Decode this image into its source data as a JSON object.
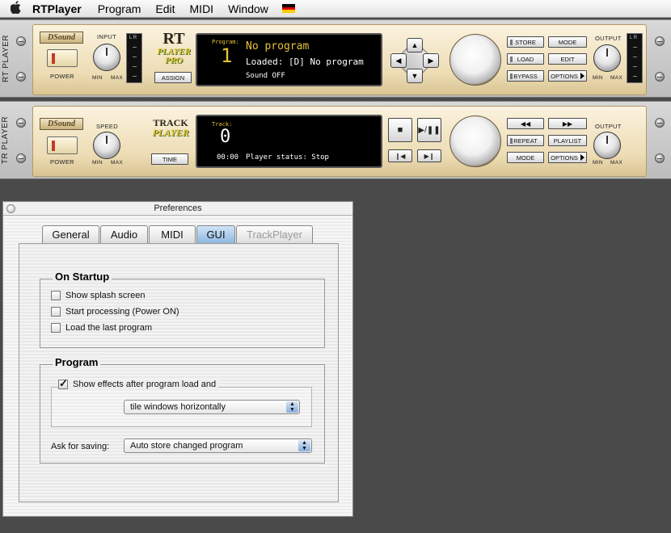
{
  "menubar": {
    "apple": "",
    "app_name": "RTPlayer",
    "items": [
      "Program",
      "Edit",
      "MIDI",
      "Window"
    ],
    "flag_colors": [
      "#000000",
      "#dd0000",
      "#ffcc00"
    ]
  },
  "rt_player": {
    "side_label": "RT PLAYER",
    "logo": "DSound",
    "power_label": "POWER",
    "input_label": "INPUT",
    "min_label": "MIN",
    "max_label": "MAX",
    "brand_line1": "RT",
    "brand_line2": "PLAYER",
    "brand_line3": "PRO",
    "assign_label": "ASSIGN",
    "screen": {
      "program_caption": "Program:",
      "program_number": "1",
      "program_name": "No program",
      "loaded": "Loaded: [D] No program",
      "sound": "Sound OFF"
    },
    "buttons": {
      "store": "STORE",
      "mode": "MODE",
      "load": "LOAD",
      "edit": "EDIT",
      "bypass": "BYPASS",
      "options": "OPTIONS"
    },
    "output_label": "OUTPUT"
  },
  "tr_player": {
    "side_label": "TR PLAYER",
    "logo": "DSound",
    "power_label": "POWER",
    "speed_label": "SPEED",
    "min_label": "MIN",
    "max_label": "MAX",
    "brand_line1": "TRACK",
    "brand_line2": "PLAYER",
    "time_label": "TIME",
    "screen": {
      "track_caption": "Track:",
      "track_number": "0",
      "time": "00:00",
      "status": "Player status: Stop"
    },
    "buttons": {
      "rewind": "◀◀",
      "forward": "▶▶",
      "repeat": "REPEAT",
      "playlist": "PLAYLIST",
      "mode": "MODE",
      "options": "OPTIONS"
    },
    "output_label": "OUTPUT"
  },
  "preferences": {
    "title": "Preferences",
    "tabs": [
      "General",
      "Audio",
      "MIDI",
      "GUI",
      "TrackPlayer"
    ],
    "active_tab": "GUI",
    "on_startup": {
      "title": "On Startup",
      "options": [
        {
          "label": "Show splash screen",
          "checked": false
        },
        {
          "label": "Start processing (Power ON)",
          "checked": false
        },
        {
          "label": "Load the last program",
          "checked": false
        }
      ]
    },
    "program": {
      "title": "Program",
      "show_effects_label": "Show effects after program load and",
      "show_effects_checked": true,
      "tile_value": "tile windows horizontally",
      "ask_label": "Ask for saving:",
      "ask_value": "Auto store changed program"
    }
  }
}
